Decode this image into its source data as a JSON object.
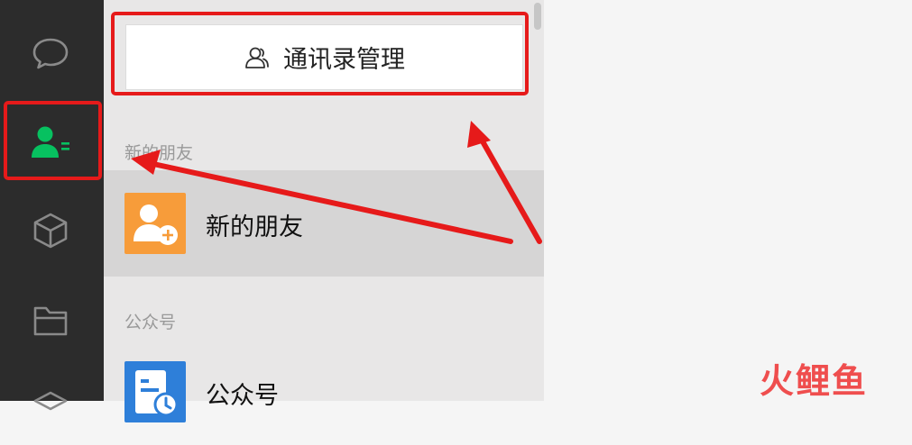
{
  "sidebar": {
    "items": [
      {
        "name": "chat",
        "icon": "chat-bubble-icon"
      },
      {
        "name": "contacts",
        "icon": "contacts-icon",
        "active": true
      },
      {
        "name": "favorites",
        "icon": "cube-icon"
      },
      {
        "name": "files",
        "icon": "folder-icon"
      },
      {
        "name": "more",
        "icon": "cube-partial-icon"
      }
    ]
  },
  "contacts": {
    "manage_button": {
      "label": "通讯录管理",
      "icon": "contacts-outline-icon"
    },
    "sections": [
      {
        "label": "新的朋友",
        "items": [
          {
            "label": "新的朋友",
            "icon": "add-friend-icon",
            "color": "#f79c3a",
            "selected": true
          }
        ]
      },
      {
        "label": "公众号",
        "items": [
          {
            "label": "公众号",
            "icon": "official-account-icon",
            "color": "#2e7fd9"
          }
        ]
      }
    ]
  },
  "annotations": {
    "color": "#e61a1a",
    "watermark": "火鲤鱼"
  },
  "colors": {
    "sidebar_bg": "#2c2c2c",
    "panel_bg": "#e8e7e7",
    "active_icon": "#07c160"
  }
}
